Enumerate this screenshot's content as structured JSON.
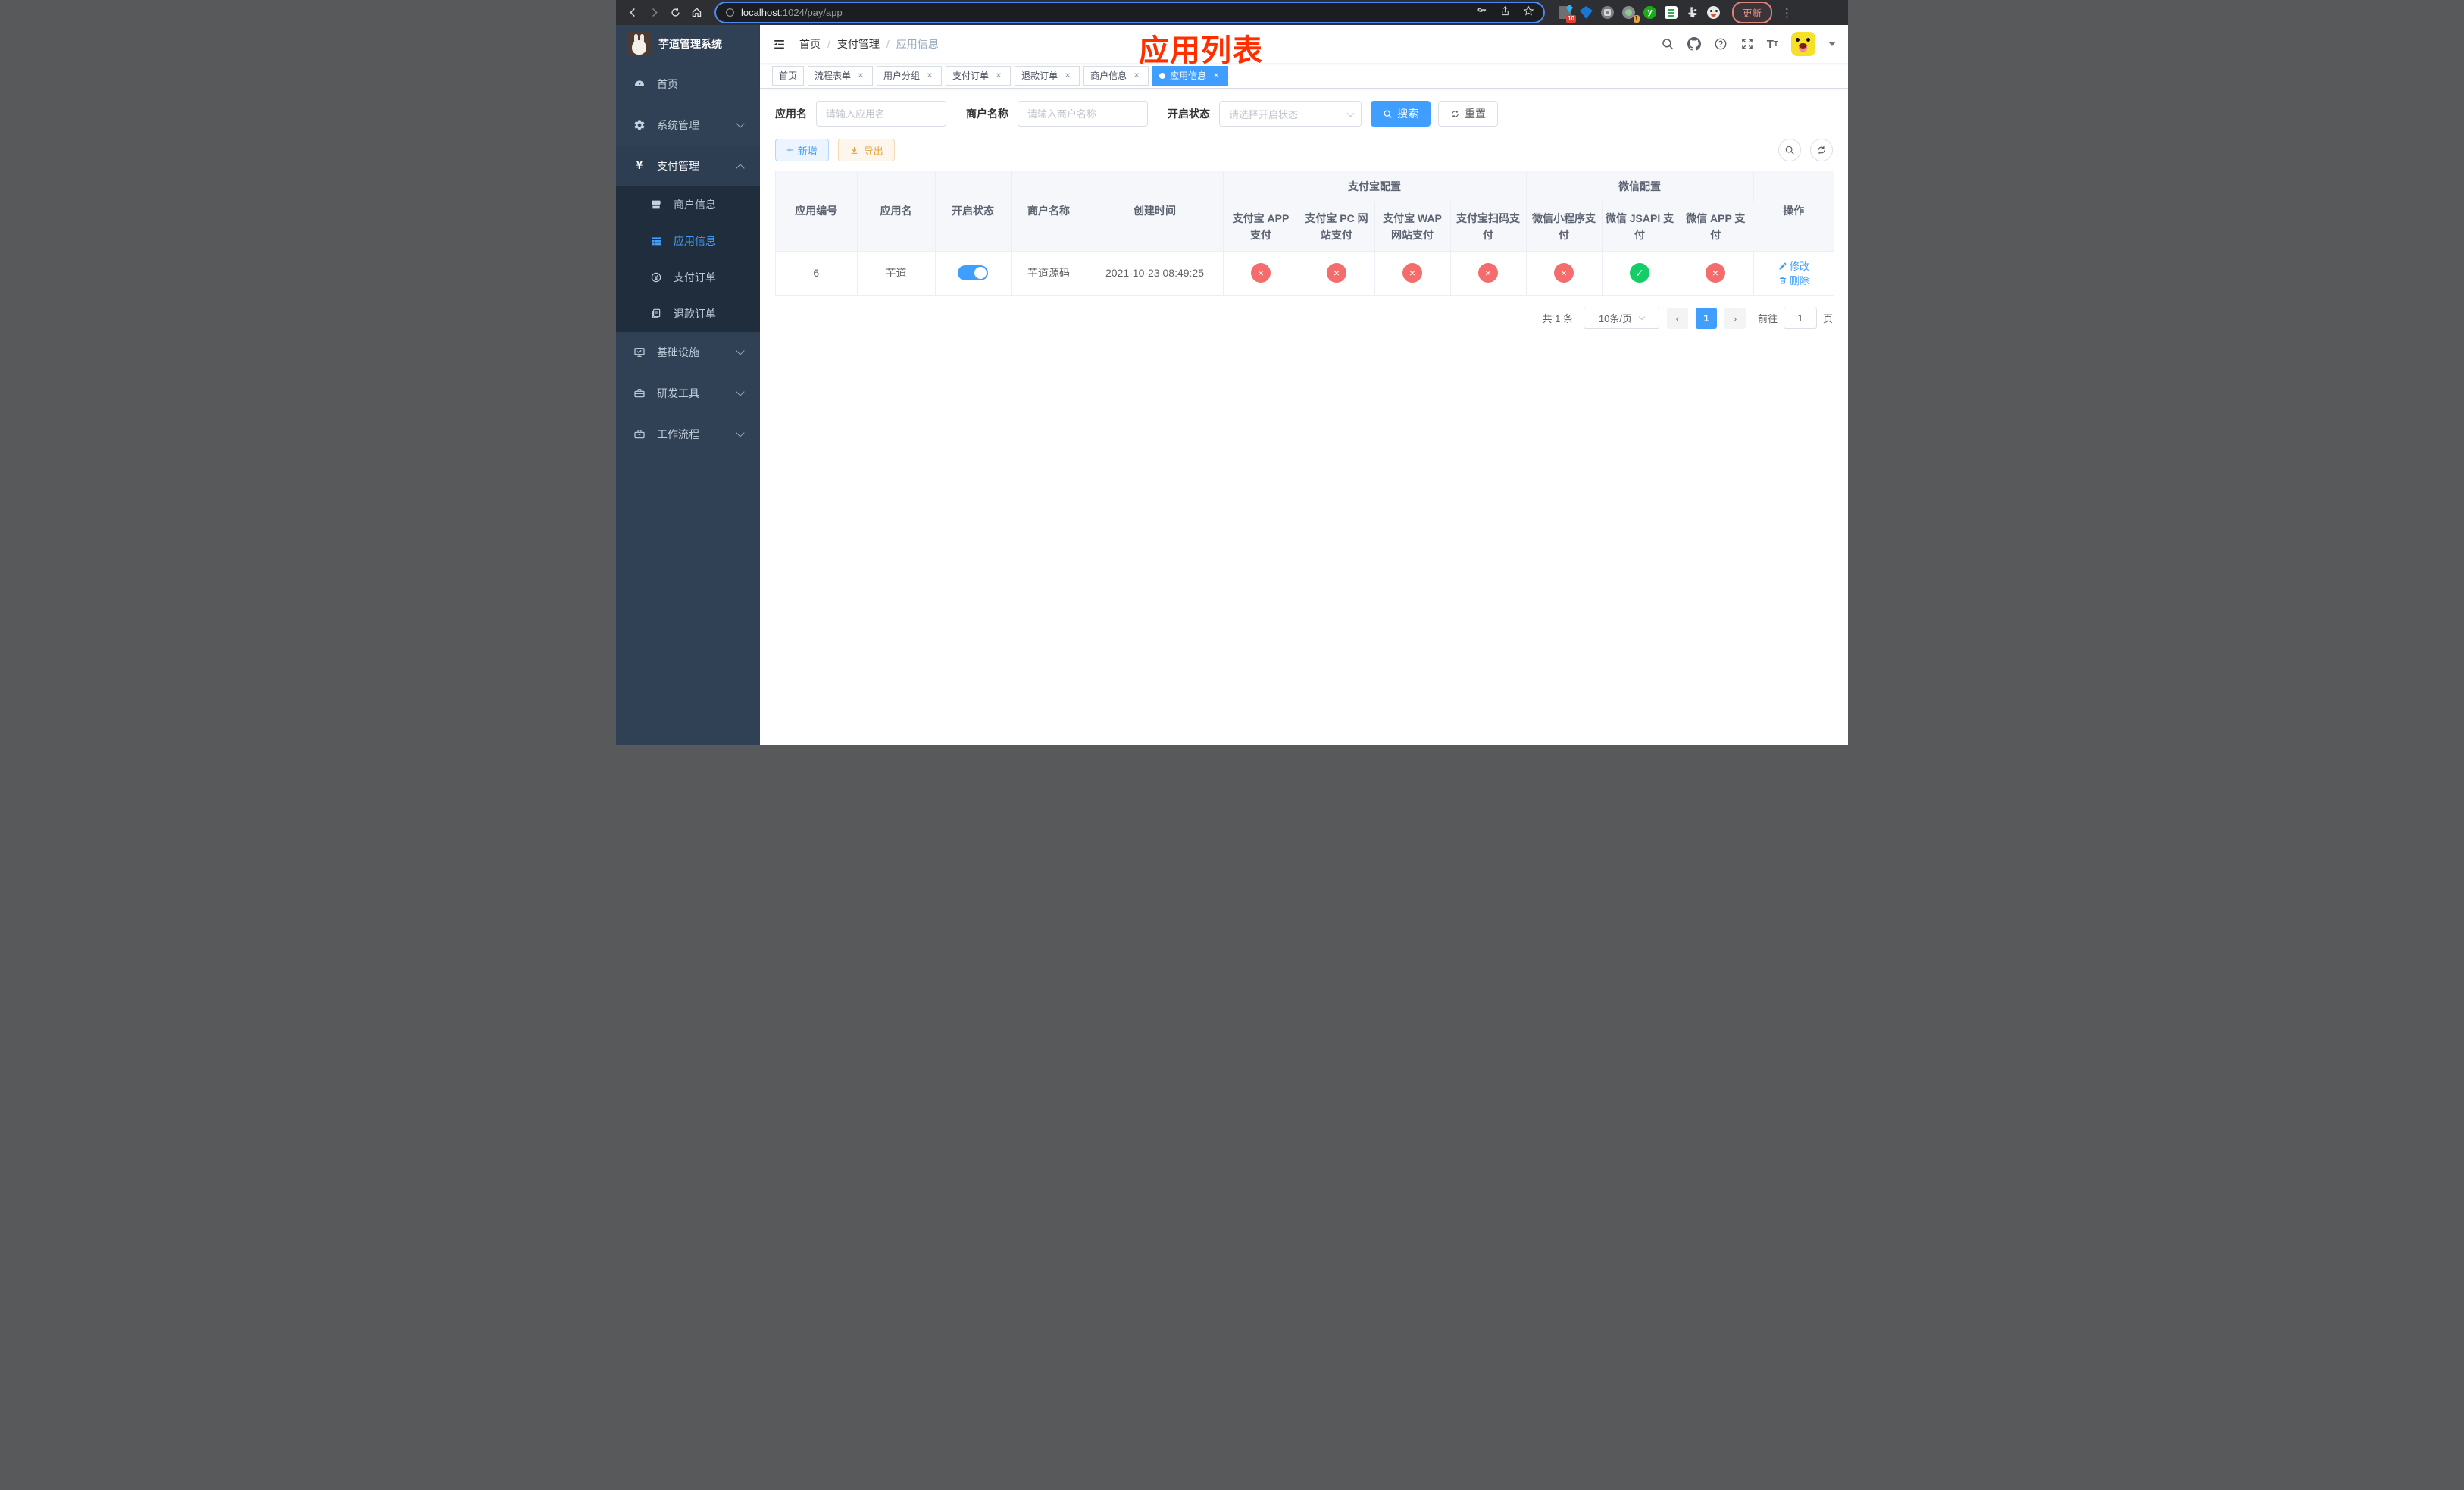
{
  "browser": {
    "url_host": "localhost",
    "url_rest": ":1024/pay/app",
    "update_button": "更新",
    "ext_badge_a": "10",
    "ext_badge_b": "1",
    "ext_y_letter": "y",
    "kebab": "⋮"
  },
  "sidebar": {
    "title": "芋道管理系统",
    "menu": [
      {
        "label": "首页"
      },
      {
        "label": "系统管理"
      },
      {
        "label": "支付管理"
      },
      {
        "label": "商户信息"
      },
      {
        "label": "应用信息"
      },
      {
        "label": "支付订单"
      },
      {
        "label": "退款订单"
      },
      {
        "label": "基础设施"
      },
      {
        "label": "研发工具"
      },
      {
        "label": "工作流程"
      }
    ]
  },
  "navbar": {
    "breadcrumb": [
      "首页",
      "支付管理",
      "应用信息"
    ]
  },
  "annotation": "应用列表",
  "tabs": [
    {
      "label": "首页"
    },
    {
      "label": "流程表单"
    },
    {
      "label": "用户分组"
    },
    {
      "label": "支付订单"
    },
    {
      "label": "退款订单"
    },
    {
      "label": "商户信息"
    },
    {
      "label": "应用信息"
    }
  ],
  "search": {
    "app_name_label": "应用名",
    "app_name_placeholder": "请输入应用名",
    "merchant_label": "商户名称",
    "merchant_placeholder": "请输入商户名称",
    "status_label": "开启状态",
    "status_placeholder": "请选择开启状态",
    "search_button": "搜索",
    "reset_button": "重置"
  },
  "toolbar": {
    "add_button": "新增",
    "export_button": "导出"
  },
  "table": {
    "col_app_id": "应用编号",
    "col_app_name": "应用名",
    "col_status": "开启状态",
    "col_merchant": "商户名称",
    "col_created": "创建时间",
    "group_alipay": "支付宝配置",
    "group_wechat": "微信配置",
    "col_ops": "操作",
    "col_alipay_app": "支付宝 APP 支付",
    "col_alipay_pc": "支付宝 PC 网站支付",
    "col_alipay_wap": "支付宝 WAP 网站支付",
    "col_alipay_qr": "支付宝扫码支付",
    "col_wx_mini": "微信小程序支付",
    "col_wx_jsapi": "微信 JSAPI 支付",
    "col_wx_app": "微信 APP 支付",
    "row": {
      "id": "6",
      "name": "芋道",
      "enabled": true,
      "merchant": "芋道源码",
      "created": "2021-10-23 08:49:25",
      "alipay_app": false,
      "alipay_pc": false,
      "alipay_wap": false,
      "alipay_qr": false,
      "wx_mini": false,
      "wx_jsapi": true,
      "wx_app": false,
      "edit_label": "修改",
      "delete_label": "删除"
    }
  },
  "pagination": {
    "total": "共 1 条",
    "per_page": "10条/页",
    "page": "1",
    "goto_prefix": "前往",
    "goto_value": "1",
    "goto_suffix": "页"
  },
  "colors": {
    "accent": "#409eff",
    "danger": "#f56c6c",
    "success": "#13ce66",
    "sidebar_bg": "#304156",
    "submenu_bg": "#1f2d3d",
    "annotation": "#ff2f00"
  }
}
